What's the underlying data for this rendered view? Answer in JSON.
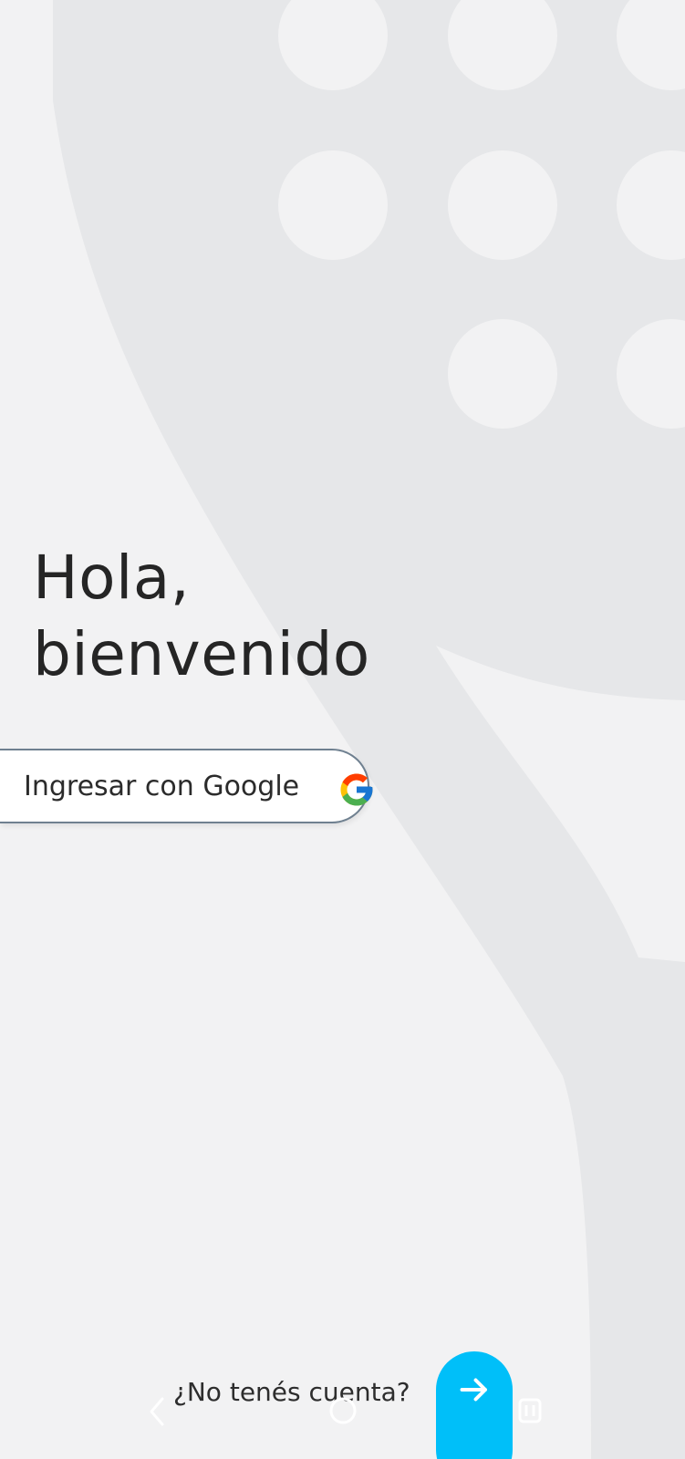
{
  "welcome": {
    "line1": "Hola,",
    "line2": "bienvenido"
  },
  "google_button": {
    "label": "Ingresar con Google",
    "icon": "google-g-icon"
  },
  "signup": {
    "prompt": "¿No tenés cuenta?",
    "button_icon": "arrow-right-icon"
  },
  "navigation": {
    "back_icon": "back-chevron-icon",
    "home_icon": "home-circle-icon",
    "recents_icon": "recents-icon"
  },
  "colors": {
    "background": "#f2f2f3",
    "background_art": "#e6e7e9",
    "accent": "#00bff9",
    "text": "#252525",
    "button_border": "#6f8090"
  }
}
